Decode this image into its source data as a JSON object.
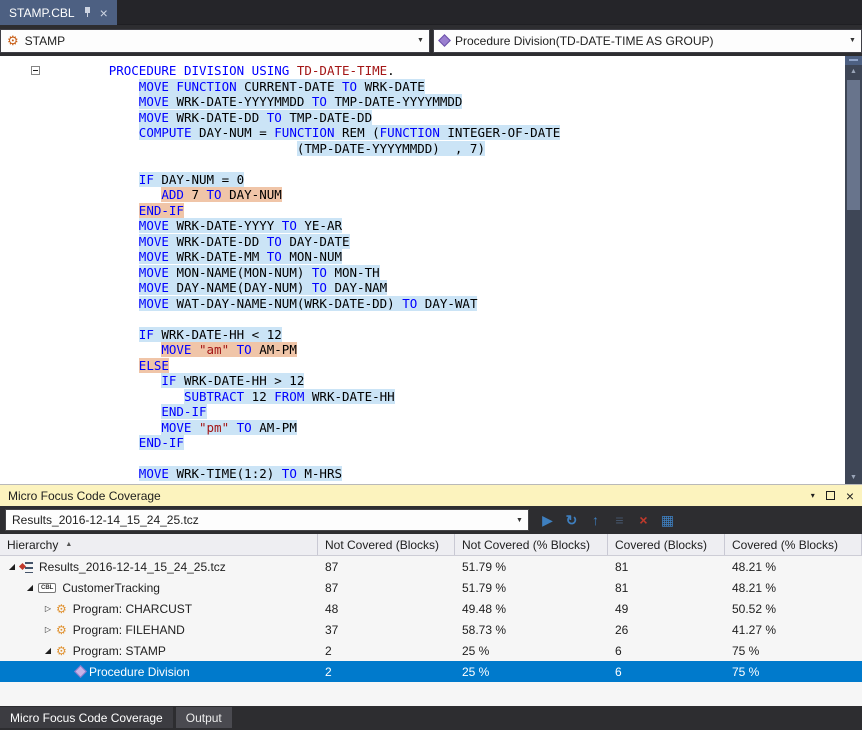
{
  "tab_bar": {
    "tabs": [
      {
        "label": "STAMP.CBL",
        "pinned": true,
        "active": true
      }
    ]
  },
  "nav_bar": {
    "scope_dropdown": {
      "value": "STAMP"
    },
    "member_dropdown": {
      "value": "Procedure Division(TD-DATE-TIME AS GROUP)"
    }
  },
  "editor": {
    "coverage_colors": {
      "covered": "#CBE4F6",
      "not_covered": "#F0C5A8"
    },
    "token_colors": {
      "keyword": "#0000FF",
      "identifier": "#000000",
      "string": "#A31515"
    },
    "lines": [
      {
        "indent": 7,
        "coverage": "none",
        "segments": [
          [
            "PROCEDURE DIVISION USING ",
            "k"
          ],
          [
            "TD-DATE-TIME",
            "s"
          ],
          [
            ".",
            "t"
          ]
        ]
      },
      {
        "indent": 11,
        "coverage": "cov",
        "segments": [
          [
            "MOVE FUNCTION ",
            "k"
          ],
          [
            "CURRENT-DATE ",
            "t"
          ],
          [
            "TO ",
            "k"
          ],
          [
            "WRK-DATE",
            "t"
          ]
        ]
      },
      {
        "indent": 11,
        "coverage": "cov",
        "segments": [
          [
            "MOVE ",
            "k"
          ],
          [
            "WRK-DATE-YYYYMMDD ",
            "t"
          ],
          [
            "TO ",
            "k"
          ],
          [
            "TMP-DATE-YYYYMMDD",
            "t"
          ]
        ]
      },
      {
        "indent": 11,
        "coverage": "cov",
        "segments": [
          [
            "MOVE ",
            "k"
          ],
          [
            "WRK-DATE-DD ",
            "t"
          ],
          [
            "TO ",
            "k"
          ],
          [
            "TMP-DATE-DD",
            "t"
          ]
        ]
      },
      {
        "indent": 11,
        "coverage": "cov",
        "segments": [
          [
            "COMPUTE ",
            "k"
          ],
          [
            "DAY-NUM = ",
            "t"
          ],
          [
            "FUNCTION ",
            "k"
          ],
          [
            "REM (",
            "t"
          ],
          [
            "FUNCTION ",
            "k"
          ],
          [
            "INTEGER-OF-DATE",
            "t"
          ]
        ]
      },
      {
        "indent": 32,
        "coverage": "cov",
        "segments": [
          [
            "(TMP-DATE-YYYYMMDD)  , 7)",
            "t"
          ]
        ]
      },
      {
        "indent": 0,
        "coverage": "none",
        "segments": []
      },
      {
        "indent": 11,
        "coverage": "cov",
        "segments": [
          [
            "IF ",
            "k"
          ],
          [
            "DAY-NUM = 0",
            "t"
          ]
        ]
      },
      {
        "indent": 14,
        "coverage": "not",
        "segments": [
          [
            "ADD ",
            "k"
          ],
          [
            "7 ",
            "t"
          ],
          [
            "TO ",
            "k"
          ],
          [
            "DAY-NUM",
            "t"
          ]
        ]
      },
      {
        "indent": 11,
        "coverage": "not",
        "segments": [
          [
            "END-IF",
            "k"
          ]
        ]
      },
      {
        "indent": 11,
        "coverage": "cov",
        "segments": [
          [
            "MOVE ",
            "k"
          ],
          [
            "WRK-DATE-YYYY ",
            "t"
          ],
          [
            "TO ",
            "k"
          ],
          [
            "YE-AR",
            "t"
          ]
        ]
      },
      {
        "indent": 11,
        "coverage": "cov",
        "segments": [
          [
            "MOVE ",
            "k"
          ],
          [
            "WRK-DATE-DD ",
            "t"
          ],
          [
            "TO ",
            "k"
          ],
          [
            "DAY-DATE",
            "t"
          ]
        ]
      },
      {
        "indent": 11,
        "coverage": "cov",
        "segments": [
          [
            "MOVE ",
            "k"
          ],
          [
            "WRK-DATE-MM ",
            "t"
          ],
          [
            "TO ",
            "k"
          ],
          [
            "MON-NUM",
            "t"
          ]
        ]
      },
      {
        "indent": 11,
        "coverage": "cov",
        "segments": [
          [
            "MOVE ",
            "k"
          ],
          [
            "MON-NAME(MON-NUM) ",
            "t"
          ],
          [
            "TO ",
            "k"
          ],
          [
            "MON-TH",
            "t"
          ]
        ]
      },
      {
        "indent": 11,
        "coverage": "cov",
        "segments": [
          [
            "MOVE ",
            "k"
          ],
          [
            "DAY-NAME(DAY-NUM) ",
            "t"
          ],
          [
            "TO ",
            "k"
          ],
          [
            "DAY-NAM",
            "t"
          ]
        ]
      },
      {
        "indent": 11,
        "coverage": "cov",
        "segments": [
          [
            "MOVE ",
            "k"
          ],
          [
            "WAT-DAY-NAME-NUM(WRK-DATE-DD) ",
            "t"
          ],
          [
            "TO ",
            "k"
          ],
          [
            "DAY-WAT",
            "t"
          ]
        ]
      },
      {
        "indent": 0,
        "coverage": "none",
        "segments": []
      },
      {
        "indent": 11,
        "coverage": "cov",
        "segments": [
          [
            "IF ",
            "k"
          ],
          [
            "WRK-DATE-HH < 12",
            "t"
          ]
        ]
      },
      {
        "indent": 14,
        "coverage": "not",
        "segments": [
          [
            "MOVE ",
            "k"
          ],
          [
            "\"am\" ",
            "s"
          ],
          [
            "TO ",
            "k"
          ],
          [
            "AM-PM",
            "t"
          ]
        ]
      },
      {
        "indent": 11,
        "coverage": "not",
        "segments": [
          [
            "ELSE",
            "k"
          ]
        ]
      },
      {
        "indent": 14,
        "coverage": "cov",
        "segments": [
          [
            "IF ",
            "k"
          ],
          [
            "WRK-DATE-HH > 12",
            "t"
          ]
        ]
      },
      {
        "indent": 17,
        "coverage": "cov",
        "segments": [
          [
            "SUBTRACT ",
            "k"
          ],
          [
            "12 ",
            "t"
          ],
          [
            "FROM ",
            "k"
          ],
          [
            "WRK-DATE-HH",
            "t"
          ]
        ]
      },
      {
        "indent": 14,
        "coverage": "cov",
        "segments": [
          [
            "END-IF",
            "k"
          ]
        ]
      },
      {
        "indent": 14,
        "coverage": "cov",
        "segments": [
          [
            "MOVE ",
            "k"
          ],
          [
            "\"pm\" ",
            "s"
          ],
          [
            "TO ",
            "k"
          ],
          [
            "AM-PM",
            "t"
          ]
        ]
      },
      {
        "indent": 11,
        "coverage": "cov",
        "segments": [
          [
            "END-IF",
            "k"
          ]
        ]
      },
      {
        "indent": 0,
        "coverage": "none",
        "segments": []
      },
      {
        "indent": 11,
        "coverage": "cov",
        "segments": [
          [
            "MOVE ",
            "k"
          ],
          [
            "WRK-TIME(1:2) ",
            "t"
          ],
          [
            "TO ",
            "k"
          ],
          [
            "M-HRS",
            "t"
          ]
        ]
      }
    ]
  },
  "coverage_panel": {
    "title": "Micro Focus Code Coverage",
    "toolbar": {
      "results_file": "Results_2016-12-14_15_24_25.tcz",
      "buttons": [
        {
          "name": "apply-results-button",
          "glyph": "▶",
          "color": "#3E7FBF"
        },
        {
          "name": "refresh-button",
          "glyph": "↻",
          "color": "#3E7FBF",
          "bold": true
        },
        {
          "name": "go-to-parent-button",
          "glyph": "↑",
          "color": "#3E7FBF",
          "bold": true
        },
        {
          "name": "collapse-all-button",
          "glyph": "≡",
          "color": "#44546A",
          "bold": true
        },
        {
          "name": "delete-results-button",
          "glyph": "×",
          "color": "#C0392B",
          "bold": true
        },
        {
          "name": "column-options-button",
          "glyph": "▦",
          "color": "#3E7FBF"
        }
      ]
    },
    "table": {
      "columns": [
        {
          "label": "Hierarchy",
          "sort": "asc"
        },
        {
          "label": "Not Covered (Blocks)"
        },
        {
          "label": "Not Covered (% Blocks)"
        },
        {
          "label": "Covered (Blocks)"
        },
        {
          "label": "Covered (% Blocks)"
        }
      ],
      "rows": [
        {
          "indent": 0,
          "expander": "expanded",
          "icon": "results",
          "label": "Results_2016-12-14_15_24_25.tcz",
          "not_covered_blocks": "87",
          "not_covered_pct": "51.79 %",
          "covered_blocks": "81",
          "covered_pct": "48.21 %",
          "selected": false
        },
        {
          "indent": 1,
          "expander": "expanded",
          "icon": "cbl",
          "label": "CustomerTracking",
          "not_covered_blocks": "87",
          "not_covered_pct": "51.79 %",
          "covered_blocks": "81",
          "covered_pct": "48.21 %",
          "selected": false
        },
        {
          "indent": 2,
          "expander": "collapsed",
          "icon": "program",
          "label": "Program: CHARCUST",
          "not_covered_blocks": "48",
          "not_covered_pct": "49.48 %",
          "covered_blocks": "49",
          "covered_pct": "50.52 %",
          "selected": false
        },
        {
          "indent": 2,
          "expander": "collapsed",
          "icon": "program",
          "label": "Program: FILEHAND",
          "not_covered_blocks": "37",
          "not_covered_pct": "58.73 %",
          "covered_blocks": "26",
          "covered_pct": "41.27 %",
          "selected": false
        },
        {
          "indent": 2,
          "expander": "expanded",
          "icon": "program",
          "label": "Program: STAMP",
          "not_covered_blocks": "2",
          "not_covered_pct": "25 %",
          "covered_blocks": "6",
          "covered_pct": "75 %",
          "selected": false
        },
        {
          "indent": 3,
          "expander": "none",
          "icon": "procedure",
          "label": "Procedure Division",
          "not_covered_blocks": "2",
          "not_covered_pct": "25 %",
          "covered_blocks": "6",
          "covered_pct": "75 %",
          "selected": true
        }
      ]
    }
  },
  "bottom_tabs": [
    {
      "label": "Micro Focus Code Coverage",
      "active": true
    },
    {
      "label": "Output",
      "active": false
    }
  ],
  "colors": {
    "selection": "#007ACC",
    "panel_title_bg": "#FCF3BE",
    "active_tab_bg": "#4D6082",
    "chrome_bg": "#2D2D30"
  }
}
